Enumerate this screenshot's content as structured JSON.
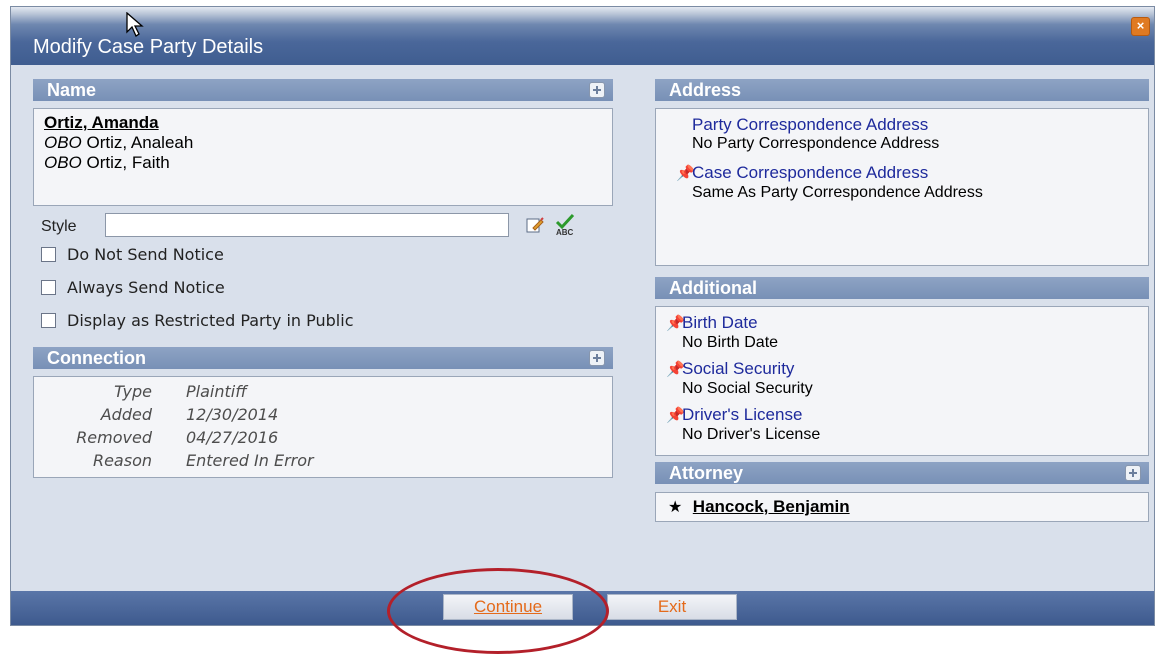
{
  "dialog": {
    "title": "Modify Case Party Details",
    "close_icon": "close-icon"
  },
  "name_panel": {
    "header": "Name",
    "primary_name": "Ortiz, Amanda",
    "obo_prefix": "OBO",
    "obo_names": [
      "Ortiz, Analeah",
      "Ortiz, Faith"
    ],
    "style_label": "Style",
    "style_value": ""
  },
  "checkboxes": [
    {
      "label": "Do Not Send Notice",
      "checked": false
    },
    {
      "label": "Always Send Notice",
      "checked": false
    },
    {
      "label": "Display as Restricted Party in Public",
      "checked": false
    }
  ],
  "connection": {
    "header": "Connection",
    "rows": [
      {
        "label": "Type",
        "value": "Plaintiff"
      },
      {
        "label": "Added",
        "value": "12/30/2014"
      },
      {
        "label": "Removed",
        "value": "04/27/2016"
      },
      {
        "label": "Reason",
        "value": "Entered In Error"
      }
    ]
  },
  "address": {
    "header": "Address",
    "items": [
      {
        "link": "Party Correspondence Address",
        "value": "No Party Correspondence Address",
        "pinned": false
      },
      {
        "link": "Case Correspondence Address",
        "value": "Same As Party Correspondence Address",
        "pinned": true
      }
    ]
  },
  "additional": {
    "header": "Additional",
    "items": [
      {
        "link": "Birth Date",
        "value": "No Birth Date"
      },
      {
        "link": "Social Security",
        "value": "No Social Security"
      },
      {
        "link": "Driver's License",
        "value": "No Driver's License"
      }
    ]
  },
  "attorney": {
    "header": "Attorney",
    "star": "★",
    "name": "Hancock, Benjamin"
  },
  "footer": {
    "continue_label": "Continue",
    "exit_label": "Exit"
  },
  "colors": {
    "titlebar": "#4a679a",
    "panel_header": "#7890b6",
    "link": "#1e2a9c",
    "button_text": "#e46a1a",
    "highlight": "#b3202a"
  }
}
